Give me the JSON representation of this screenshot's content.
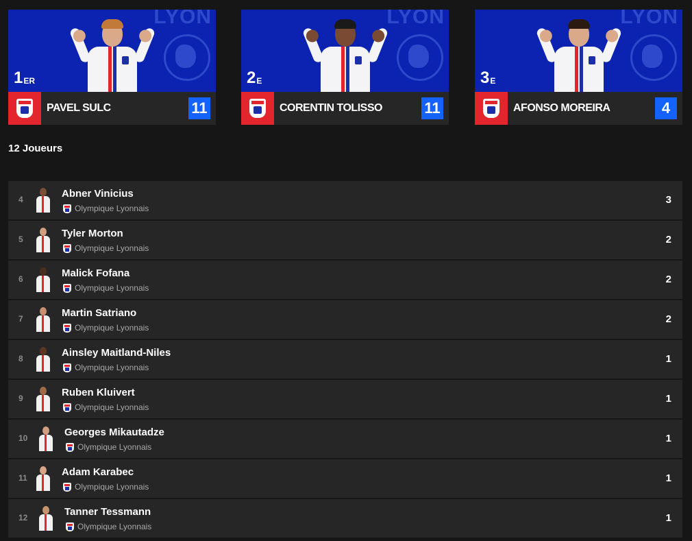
{
  "podium": [
    {
      "rank_num": "1",
      "rank_suffix": "ER",
      "name": "PAVEL SULC",
      "score": "11",
      "hair": "#c27a3a"
    },
    {
      "rank_num": "2",
      "rank_suffix": "E",
      "name": "CORENTIN TOLISSO",
      "score": "11",
      "hair": "#1a1a1a"
    },
    {
      "rank_num": "3",
      "rank_suffix": "E",
      "name": "AFONSO MOREIRA",
      "score": "4",
      "hair": "#2a1a10"
    }
  ],
  "watermark_word": "LYON",
  "player_count": "12 Joueurs",
  "club_name": "Olympique Lyonnais",
  "players": [
    {
      "rank": "4",
      "name": "Abner Vinicius",
      "club": "Olympique Lyonnais",
      "value": "3"
    },
    {
      "rank": "5",
      "name": "Tyler Morton",
      "club": "Olympique Lyonnais",
      "value": "2"
    },
    {
      "rank": "6",
      "name": "Malick Fofana",
      "club": "Olympique Lyonnais",
      "value": "2"
    },
    {
      "rank": "7",
      "name": "Martin Satriano",
      "club": "Olympique Lyonnais",
      "value": "2"
    },
    {
      "rank": "8",
      "name": "Ainsley Maitland-Niles",
      "club": "Olympique Lyonnais",
      "value": "1"
    },
    {
      "rank": "9",
      "name": "Ruben Kluivert",
      "club": "Olympique Lyonnais",
      "value": "1"
    },
    {
      "rank": "10",
      "name": "Georges Mikautadze",
      "club": "Olympique Lyonnais",
      "value": "1"
    },
    {
      "rank": "11",
      "name": "Adam Karabec",
      "club": "Olympique Lyonnais",
      "value": "1"
    },
    {
      "rank": "12",
      "name": "Tanner Tessmann",
      "club": "Olympique Lyonnais",
      "value": "1"
    }
  ],
  "colors": {
    "hero_blue": "#0b23b0",
    "score_blue": "#1463ff",
    "club_red": "#e3262d",
    "row_bg": "#262626",
    "page_bg": "#161616"
  }
}
